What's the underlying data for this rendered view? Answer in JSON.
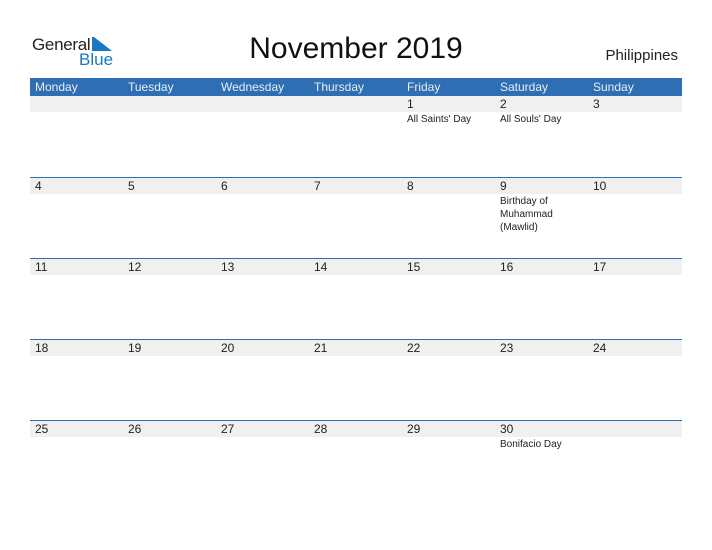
{
  "logo": {
    "part1": "General",
    "part2": "Blue"
  },
  "title": "November 2019",
  "country": "Philippines",
  "colors": {
    "header_bg": "#2e6fb3",
    "accent": "#1a78c2",
    "row_bg": "#f0f0f0"
  },
  "weekdays": [
    "Monday",
    "Tuesday",
    "Wednesday",
    "Thursday",
    "Friday",
    "Saturday",
    "Sunday"
  ],
  "weeks": [
    {
      "days": [
        "",
        "",
        "",
        "",
        "1",
        "2",
        "3"
      ],
      "events": [
        "",
        "",
        "",
        "",
        "All Saints' Day",
        "All Souls' Day",
        ""
      ]
    },
    {
      "days": [
        "4",
        "5",
        "6",
        "7",
        "8",
        "9",
        "10"
      ],
      "events": [
        "",
        "",
        "",
        "",
        "",
        "Birthday of Muhammad (Mawlid)",
        ""
      ]
    },
    {
      "days": [
        "11",
        "12",
        "13",
        "14",
        "15",
        "16",
        "17"
      ],
      "events": [
        "",
        "",
        "",
        "",
        "",
        "",
        ""
      ]
    },
    {
      "days": [
        "18",
        "19",
        "20",
        "21",
        "22",
        "23",
        "24"
      ],
      "events": [
        "",
        "",
        "",
        "",
        "",
        "",
        ""
      ]
    },
    {
      "days": [
        "25",
        "26",
        "27",
        "28",
        "29",
        "30",
        ""
      ],
      "events": [
        "",
        "",
        "",
        "",
        "",
        "Bonifacio Day",
        ""
      ]
    }
  ]
}
